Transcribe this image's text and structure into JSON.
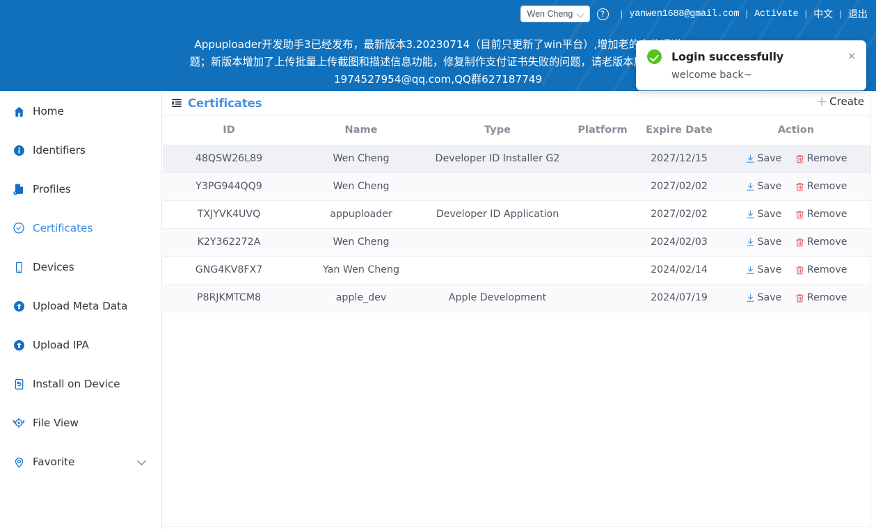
{
  "header": {
    "user_select_value": "Wen Cheng",
    "help_icon": "question-circle-icon",
    "email": "yanwen1688@gmail.com",
    "activate_label": "Activate",
    "language_label": "中文",
    "logout_label": "退出",
    "separator": "|",
    "background_color": "#1070bc"
  },
  "banner": {
    "line1": "Appuploader开发助手3已经发布，最新版本3.20230714（目前只更新了win平台）,增加老的上传通道",
    "line2": "题；新版本增加了上传批量上传截图和描述信息功能，修复制作支付证书失败的问题，请老版本用户及时更",
    "line3": "1974527954@qq.com,QQ群627187749"
  },
  "toast": {
    "icon": "success-check-icon",
    "title": "Login successfully",
    "body": "welcome back~",
    "close_icon": "close-icon",
    "accent_color": "#52c41a"
  },
  "sidebar": {
    "items": [
      {
        "label": "Home",
        "icon": "home-icon",
        "active": false,
        "expandable": false
      },
      {
        "label": "Identifiers",
        "icon": "info-circle-icon",
        "active": false,
        "expandable": false
      },
      {
        "label": "Profiles",
        "icon": "profile-file-icon",
        "active": false,
        "expandable": false
      },
      {
        "label": "Certificates",
        "icon": "certificate-badge-icon",
        "active": true,
        "expandable": false
      },
      {
        "label": "Devices",
        "icon": "mobile-device-icon",
        "active": false,
        "expandable": false
      },
      {
        "label": "Upload Meta Data",
        "icon": "upload-circle-icon",
        "active": false,
        "expandable": false
      },
      {
        "label": "Upload IPA",
        "icon": "upload-circle-icon",
        "active": false,
        "expandable": false
      },
      {
        "label": "Install on Device",
        "icon": "install-device-icon",
        "active": false,
        "expandable": false
      },
      {
        "label": "File View",
        "icon": "file-view-gear-icon",
        "active": false,
        "expandable": false
      },
      {
        "label": "Favorite",
        "icon": "location-pin-icon",
        "active": false,
        "expandable": true
      }
    ],
    "active_color": "#3e8ee0"
  },
  "main": {
    "panel_icon": "list-indent-icon",
    "panel_title": "Certificates",
    "create_label": "Create",
    "create_icon": "plus-icon",
    "table": {
      "columns": [
        "ID",
        "Name",
        "Type",
        "Platform",
        "Expire Date",
        "Action"
      ],
      "rows": [
        {
          "id": "48QSW26L89",
          "name": "Wen Cheng",
          "type": "Developer ID Installer G2",
          "platform": "",
          "expire_date": "2027/12/15",
          "save_label": "Save",
          "remove_label": "Remove"
        },
        {
          "id": "Y3PG944QQ9",
          "name": "Wen Cheng",
          "type": "",
          "platform": "",
          "expire_date": "2027/02/02",
          "save_label": "Save",
          "remove_label": "Remove"
        },
        {
          "id": "TXJYVK4UVQ",
          "name": "appuploader",
          "type": "Developer ID Application",
          "platform": "",
          "expire_date": "2027/02/02",
          "save_label": "Save",
          "remove_label": "Remove"
        },
        {
          "id": "K2Y362272A",
          "name": "Wen Cheng",
          "type": "",
          "platform": "",
          "expire_date": "2024/02/03",
          "save_label": "Save",
          "remove_label": "Remove"
        },
        {
          "id": "GNG4KV8FX7",
          "name": "Yan Wen Cheng",
          "type": "",
          "platform": "",
          "expire_date": "2024/02/14",
          "save_label": "Save",
          "remove_label": "Remove"
        },
        {
          "id": "P8RJKMTCM8",
          "name": "apple_dev",
          "type": "Apple Development",
          "platform": "",
          "expire_date": "2024/07/19",
          "save_label": "Save",
          "remove_label": "Remove"
        }
      ]
    }
  }
}
